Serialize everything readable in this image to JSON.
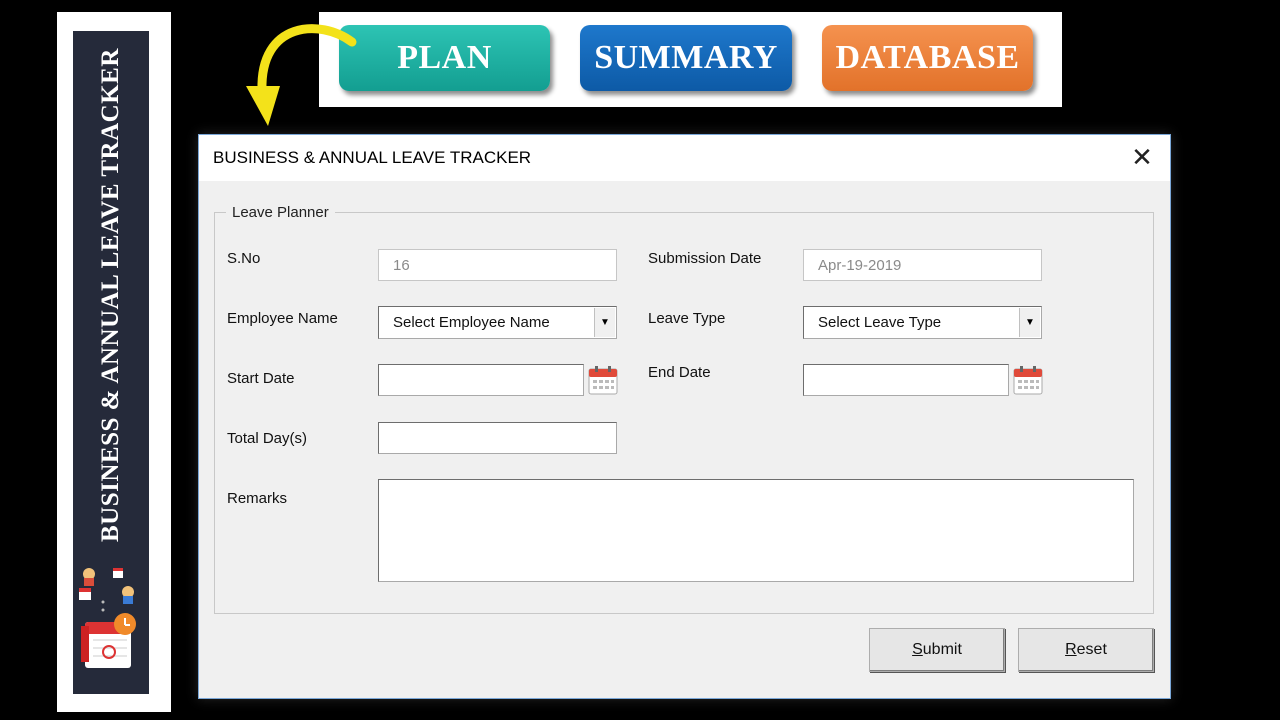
{
  "sidebar": {
    "title": "BUSINESS & ANNUAL LEAVE TRACKER"
  },
  "nav": {
    "plan": "PLAN",
    "summary": "SUMMARY",
    "database": "DATABASE"
  },
  "dialog": {
    "title": "BUSINESS & ANNUAL LEAVE TRACKER",
    "group_label": "Leave Planner",
    "fields": {
      "sno": {
        "label": "S.No",
        "value": "16"
      },
      "submission_date": {
        "label": "Submission Date",
        "value": "Apr-19-2019"
      },
      "employee_name": {
        "label": "Employee Name",
        "value": "Select Employee Name"
      },
      "leave_type": {
        "label": "Leave Type",
        "value": "Select Leave Type"
      },
      "start_date": {
        "label": "Start Date",
        "value": ""
      },
      "end_date": {
        "label": "End Date",
        "value": ""
      },
      "total_days": {
        "label": "Total Day(s)",
        "value": ""
      },
      "remarks": {
        "label": "Remarks",
        "value": ""
      }
    },
    "buttons": {
      "submit_first": "S",
      "submit_rest": "ubmit",
      "reset_first": "R",
      "reset_rest": "eset"
    }
  },
  "colors": {
    "plan": "#1aae9f",
    "summary": "#1368bb",
    "database": "#ec813a",
    "sidebar": "#252a3a"
  }
}
